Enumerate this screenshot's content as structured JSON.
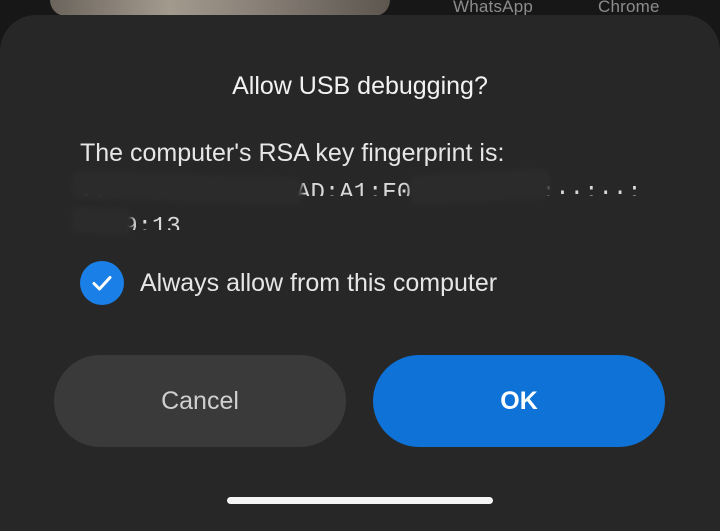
{
  "background": {
    "apps": [
      "WhatsApp",
      "Chrome"
    ]
  },
  "dialog": {
    "title": "Allow USB debugging?",
    "message": "The computer's RSA key fingerprint is:",
    "fingerprint_line1": "77:··:··:··:··:AD:A1:E0:B2:71:··:··:··:FD:A8:03:",
    "fingerprint_line2": "··:9:13",
    "checkbox": {
      "label": "Always allow from this computer",
      "checked": true
    },
    "buttons": {
      "cancel": "Cancel",
      "ok": "OK"
    }
  },
  "colors": {
    "accent": "#0e72d6",
    "dialog_bg": "#272727",
    "cancel_bg": "#3a3a3a"
  }
}
